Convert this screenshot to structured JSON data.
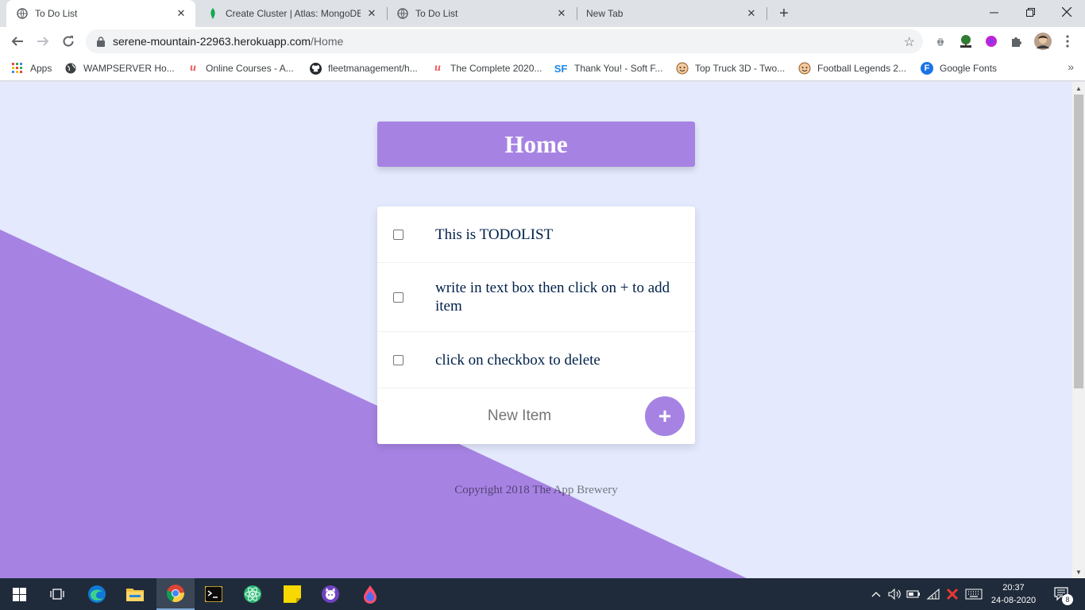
{
  "browser": {
    "tabs": [
      {
        "title": "To Do List",
        "active": true
      },
      {
        "title": "Create Cluster | Atlas: MongoDB",
        "active": false
      },
      {
        "title": "To Do List",
        "active": false
      },
      {
        "title": "New Tab",
        "active": false
      }
    ],
    "url_host": "serene-mountain-22963.herokuapp.com",
    "url_path": "/Home"
  },
  "bookmarks": [
    {
      "label": "Apps",
      "icon": "apps-grid-icon"
    },
    {
      "label": "WAMPSERVER Ho...",
      "icon": "globe-icon"
    },
    {
      "label": "Online Courses - A...",
      "icon": "udemy-icon"
    },
    {
      "label": "fleetmanagement/h...",
      "icon": "github-icon"
    },
    {
      "label": "The Complete 2020...",
      "icon": "udemy-icon"
    },
    {
      "label": "Thank You! - Soft F...",
      "icon": "sf-icon",
      "icon_text": "SF"
    },
    {
      "label": "Top Truck 3D - Two...",
      "icon": "game-face-icon"
    },
    {
      "label": "Football Legends 2...",
      "icon": "game-face-icon"
    },
    {
      "label": "Google Fonts",
      "icon": "google-fonts-icon",
      "icon_text": "F"
    }
  ],
  "page": {
    "heading": "Home",
    "items": [
      {
        "text": "This is TODOLIST",
        "checked": false
      },
      {
        "text": "write in text box then click on + to add item",
        "checked": false
      },
      {
        "text": "click on checkbox to delete",
        "checked": false
      }
    ],
    "new_item_placeholder": "New Item",
    "add_button_label": "+",
    "footer": "Copyright 2018 The App Brewery"
  },
  "taskbar": {
    "time": "20:37",
    "date": "24-08-2020",
    "notification_count": "8"
  },
  "colors": {
    "accent": "#a683e3",
    "page_bg": "#e4e9fd",
    "item_text": "#00204a",
    "taskbar": "#1f2b3a"
  }
}
